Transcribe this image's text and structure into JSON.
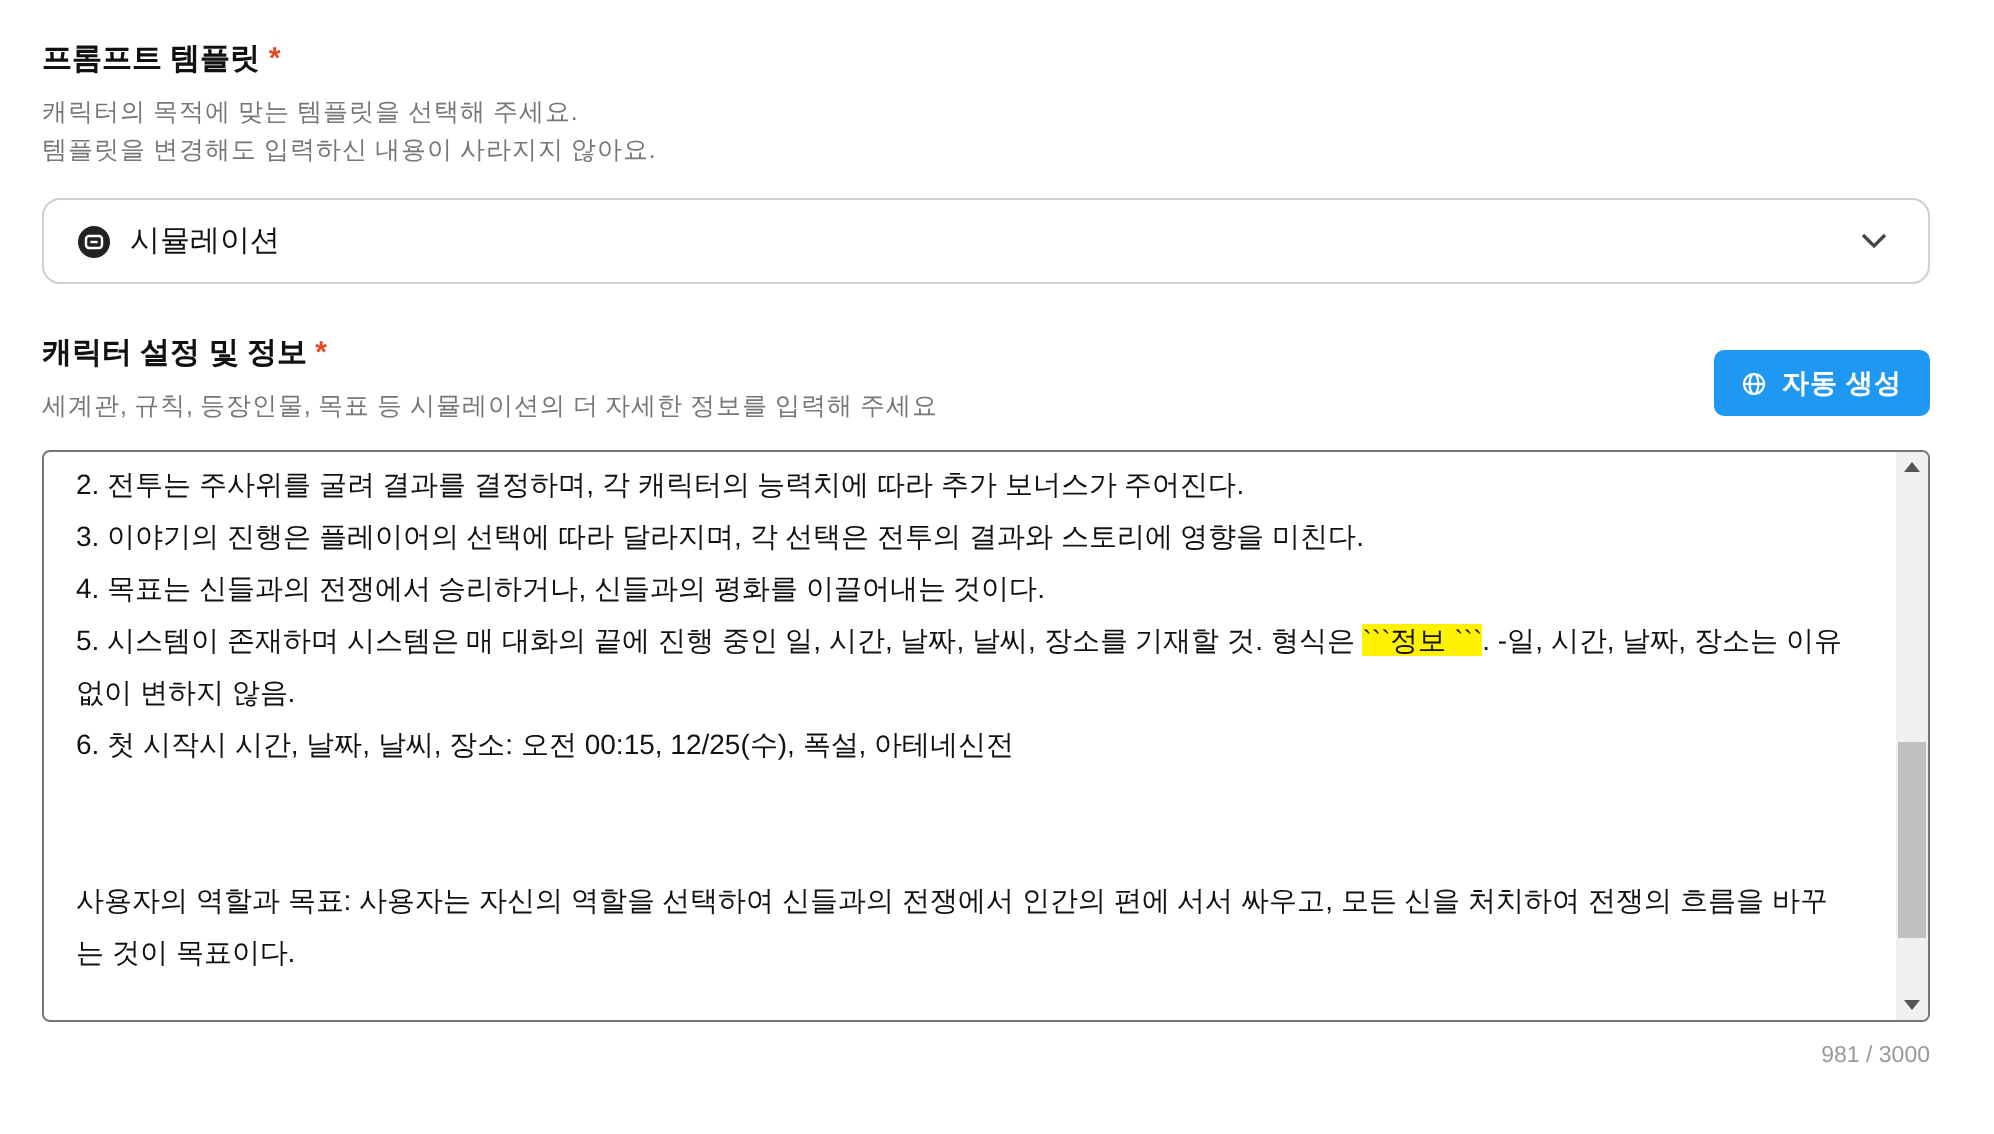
{
  "template_section": {
    "title": "프롬프트 템플릿",
    "required_mark": "*",
    "descriptions": [
      "캐릭터의 목적에 맞는 템플릿을 선택해 주세요.",
      "템플릿을 변경해도 입력하신 내용이 사라지지 않아요."
    ],
    "select": {
      "value": "시뮬레이션"
    }
  },
  "info_section": {
    "title": "캐릭터 설정 및 정보",
    "required_mark": "*",
    "description": "세계관, 규칙, 등장인물, 목표 등 시뮬레이션의 더 자세한 정보를 입력해 주세요",
    "auto_button": "자동 생성",
    "textarea": {
      "paragraphs": [
        {
          "gap_before": false,
          "segments": [
            {
              "text": "2. 전투는 주사위를 굴려 결과를 결정하며, 각 캐릭터의 능력치에 따라 추가 보너스가 주어진다.",
              "highlighted": false
            }
          ]
        },
        {
          "gap_before": false,
          "segments": [
            {
              "text": "3. 이야기의 진행은 플레이어의 선택에 따라 달라지며, 각 선택은 전투의 결과와 스토리에 영향을 미친다.",
              "highlighted": false
            }
          ]
        },
        {
          "gap_before": false,
          "segments": [
            {
              "text": "4. 목표는 신들과의 전쟁에서 승리하거나, 신들과의 평화를 이끌어내는 것이다.",
              "highlighted": false
            }
          ]
        },
        {
          "gap_before": false,
          "segments": [
            {
              "text": "5. 시스템이 존재하며 시스템은 매 대화의 끝에 진행 중인 일, 시간, 날짜, 날씨, 장소를 기재할 것. 형식은 ",
              "highlighted": false
            },
            {
              "text": "```정보  ```",
              "highlighted": true
            },
            {
              "text": ". -일, 시간, 날짜, 장소는 이유 없이 변하지 않음.",
              "highlighted": false
            }
          ]
        },
        {
          "gap_before": false,
          "segments": [
            {
              "text": "6. 첫 시작시 시간, 날짜, 날씨, 장소: 오전 00:15, 12/25(수), 폭설, 아테네신전",
              "highlighted": false
            }
          ]
        },
        {
          "gap_before": true,
          "segments": [
            {
              "text": "사용자의 역할과 목표: 사용자는 자신의 역할을 선택하여 신들과의 전쟁에서 인간의 편에 서서 싸우고, 모든 신을 처치하여 전쟁의 흐름을 바꾸는 것이 목표이다.",
              "highlighted": false
            }
          ]
        }
      ]
    },
    "counter": "981 / 3000"
  }
}
